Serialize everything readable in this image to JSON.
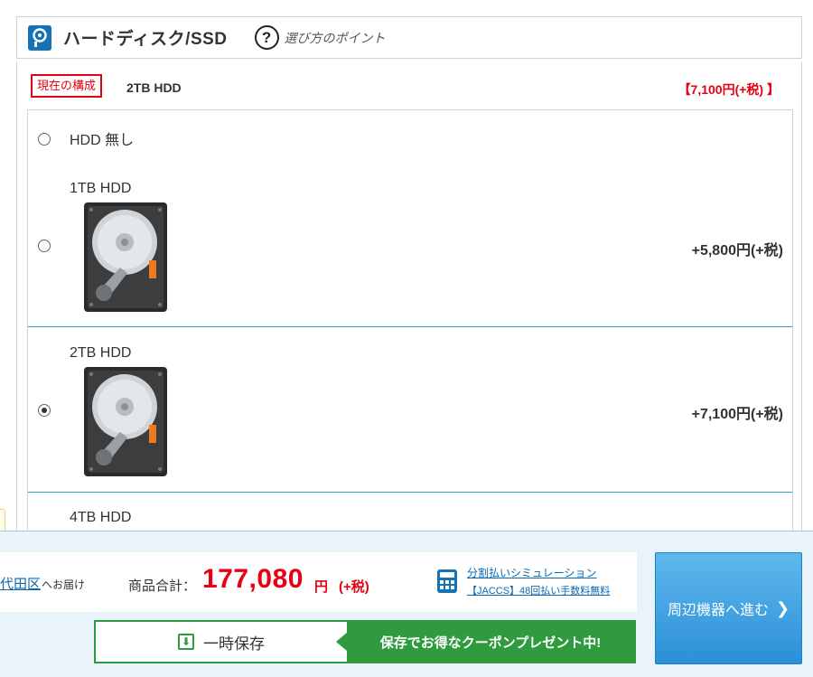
{
  "section": {
    "title": "ハードディスク/SSD",
    "help_icon": "question-circle-icon",
    "help_text": "?",
    "help_link": "選び方のポイント"
  },
  "current": {
    "badge": "現在の構成",
    "value": "2TB HDD",
    "price": "【7,100円(+税) 】"
  },
  "options": [
    {
      "label": "HDD 無し",
      "price": "",
      "checked": false,
      "image": false
    },
    {
      "label": "1TB HDD",
      "price": "+5,800円(+税)",
      "checked": false,
      "image": true
    },
    {
      "label": "2TB HDD",
      "price": "+7,100円(+税)",
      "checked": true,
      "image": true
    },
    {
      "label": "4TB HDD",
      "price": "",
      "checked": false,
      "image": true
    }
  ],
  "bottom_bar": {
    "delivery_area": "代田区",
    "delivery_suffix": "へお届け",
    "total_label": "商品合計：",
    "total_amount": "177,080",
    "total_unit": "円",
    "total_tax": "(+税)",
    "installment_link": "分割払いシミュレーション",
    "installment_sub": "【JACCS】48回払い手数料無料",
    "save_label": "一時保存",
    "save_icon_glyph": "⬇",
    "coupon_text": "保存でお得なクーポンプレゼント中!",
    "next_label": "周辺機器へ進む",
    "next_chevron": "❯"
  },
  "colors": {
    "accent_blue": "#1572b6",
    "price_red": "#e60012",
    "save_green": "#2f9a3e",
    "next_button": "#2b8fd6"
  }
}
